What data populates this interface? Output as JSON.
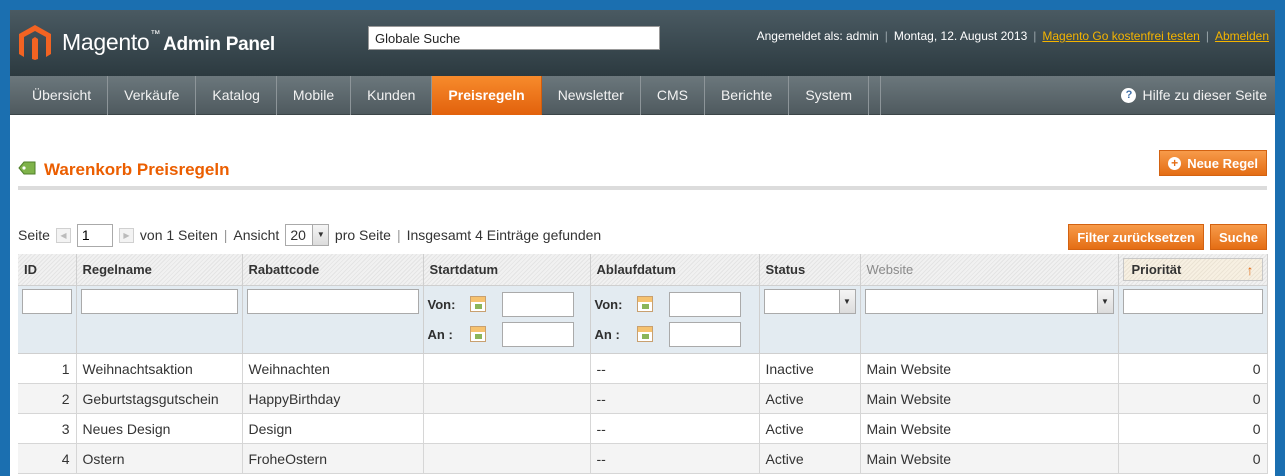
{
  "header": {
    "logo_main": "Magento",
    "logo_tm": "™",
    "logo_sub": "Admin Panel",
    "search_value": "Globale Suche",
    "logged_in": "Angemeldet als: admin",
    "date": "Montag, 12. August 2013",
    "go_link": "Magento Go kostenfrei testen",
    "logout": "Abmelden"
  },
  "nav": {
    "items": [
      {
        "label": "Übersicht"
      },
      {
        "label": "Verkäufe"
      },
      {
        "label": "Katalog"
      },
      {
        "label": "Mobile"
      },
      {
        "label": "Kunden"
      },
      {
        "label": "Preisregeln"
      },
      {
        "label": "Newsletter"
      },
      {
        "label": "CMS"
      },
      {
        "label": "Berichte"
      },
      {
        "label": "System"
      }
    ],
    "active": "Preisregeln",
    "help": "Hilfe zu dieser Seite"
  },
  "page": {
    "title": "Warenkorb Preisregeln",
    "new_rule": "Neue Regel"
  },
  "pager": {
    "page_label": "Seite",
    "page_value": "1",
    "of_pages": "von 1 Seiten",
    "view_label": "Ansicht",
    "view_value": "20",
    "per_page": "pro Seite",
    "total": "Insgesamt 4 Einträge gefunden",
    "reset_filter": "Filter zurücksetzen",
    "search": "Suche"
  },
  "grid": {
    "columns": [
      "ID",
      "Regelname",
      "Rabattcode",
      "Startdatum",
      "Ablaufdatum",
      "Status",
      "Website",
      "Priorität"
    ],
    "filter_from": "Von:",
    "filter_to": "An :",
    "rows": [
      {
        "id": "1",
        "name": "Weihnachtsaktion",
        "code": "Weihnachten",
        "start": "",
        "end": "--",
        "status": "Inactive",
        "website": "Main Website",
        "priority": "0"
      },
      {
        "id": "2",
        "name": "Geburtstagsgutschein",
        "code": "HappyBirthday",
        "start": "",
        "end": "--",
        "status": "Active",
        "website": "Main Website",
        "priority": "0"
      },
      {
        "id": "3",
        "name": "Neues Design",
        "code": "Design",
        "start": "",
        "end": "--",
        "status": "Active",
        "website": "Main Website",
        "priority": "0"
      },
      {
        "id": "4",
        "name": "Ostern",
        "code": "FroheOstern",
        "start": "",
        "end": "--",
        "status": "Active",
        "website": "Main Website",
        "priority": "0"
      }
    ]
  },
  "colors": {
    "accent_orange": "#e46d14",
    "frame_blue": "#1b6fb0",
    "header_dark": "#2c3a40",
    "title_orange": "#eb5e00"
  }
}
